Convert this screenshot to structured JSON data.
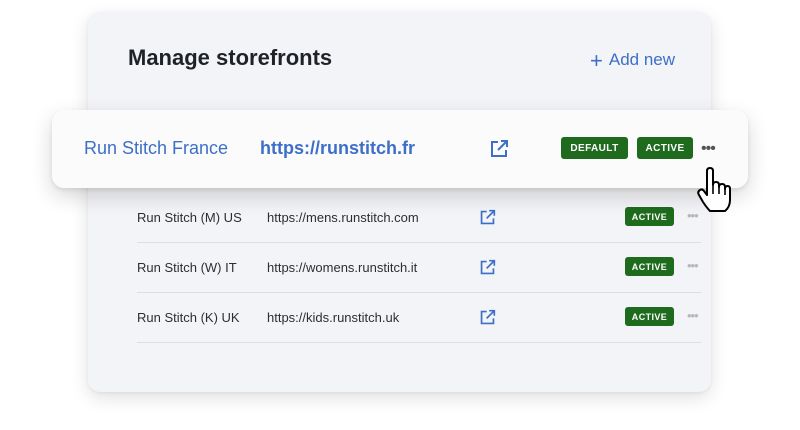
{
  "header": {
    "title": "Manage storefronts",
    "add_label": "Add new"
  },
  "featured": {
    "name": "Run Stitch France",
    "url": "https://runstitch.fr",
    "badge_default": "DEFAULT",
    "badge_active": "ACTIVE",
    "more": "•••"
  },
  "stores": [
    {
      "name": "Run Stitch (M) US",
      "url": "https://mens.runstitch.com",
      "status": "ACTIVE",
      "more": "•••"
    },
    {
      "name": "Run Stitch (W) IT",
      "url": "https://womens.runstitch.it",
      "status": "ACTIVE",
      "more": "•••"
    },
    {
      "name": "Run Stitch (K) UK",
      "url": "https://kids.runstitch.uk",
      "status": "ACTIVE",
      "more": "•••"
    }
  ],
  "colors": {
    "link": "#3d6fc9",
    "badge_green": "#1e6b1e",
    "panel": "#f3f4f7"
  },
  "icons": {
    "external": "external-link-icon",
    "add": "plus-icon",
    "more": "more-options-icon",
    "cursor": "hand-pointer-icon"
  }
}
